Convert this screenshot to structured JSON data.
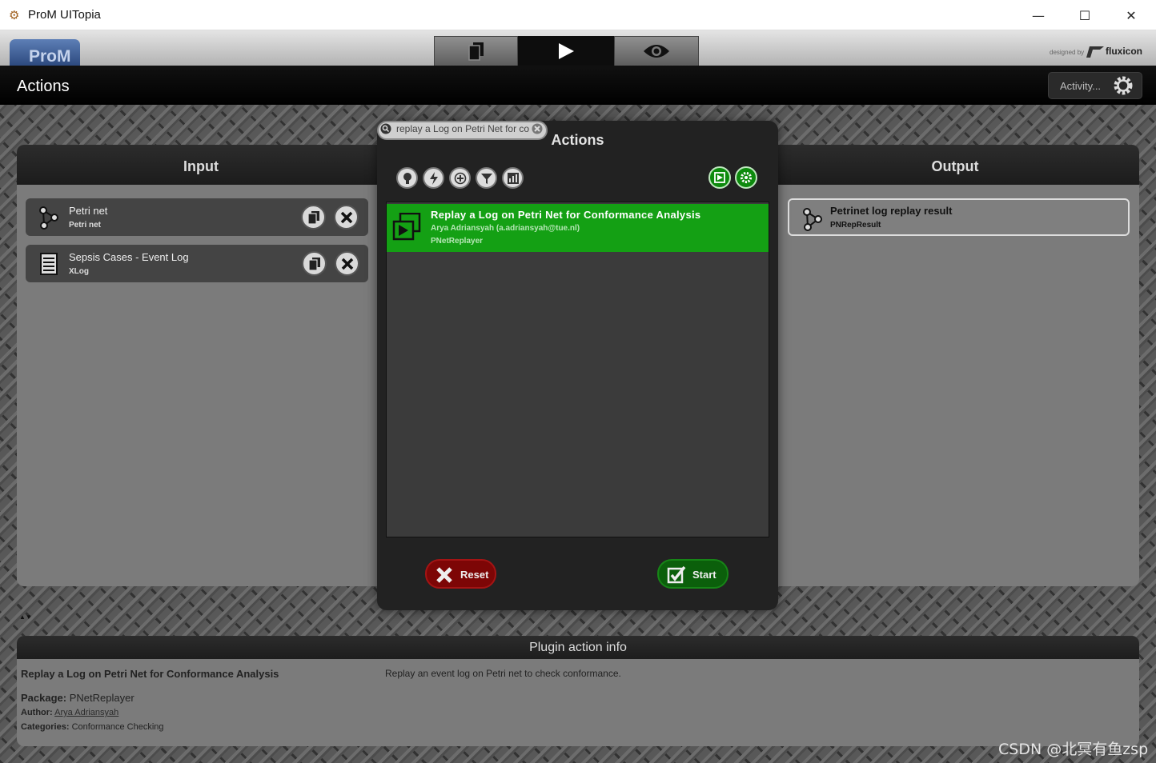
{
  "window": {
    "title": "ProM UITopia",
    "minimize_glyph": "—",
    "maximize_glyph": "☐",
    "close_glyph": "✕"
  },
  "header": {
    "logo": "ProM",
    "designed_by": "designed by",
    "brand": "fluxicon",
    "view_tabs": [
      "workspace",
      "actions",
      "views"
    ]
  },
  "actions_bar": {
    "title": "Actions",
    "activity_label": "Activity..."
  },
  "input_panel": {
    "title": "Input",
    "objects": [
      {
        "name": "Petri net",
        "type": "Petri net",
        "icon": "petri-net-icon"
      },
      {
        "name": "Sepsis Cases - Event Log",
        "type": "XLog",
        "icon": "document-icon"
      }
    ]
  },
  "output_panel": {
    "title": "Output",
    "objects": [
      {
        "name": "Petrinet log replay result",
        "type": "PNRepResult",
        "icon": "petri-net-icon"
      }
    ]
  },
  "actions_dialog": {
    "title": "Actions",
    "search_value": "replay a Log on Petri Net for co",
    "selected_action": {
      "title": "Replay a Log on Petri Net for Conformance Analysis",
      "author": "Arya Adriansyah (a.adriansyah@tue.nl)",
      "package": "PNetReplayer"
    },
    "reset_label": "Reset",
    "start_label": "Start"
  },
  "plugin_info": {
    "title": "Plugin action info",
    "name": "Replay a Log on Petri Net for Conformance Analysis",
    "description": "Replay an event log on Petri net to check conformance.",
    "package_label": "Package:",
    "package": "PNetReplayer",
    "author_label": "Author:",
    "author": "Arya Adriansyah",
    "categories_label": "Categories:",
    "categories": "Conformance Checking"
  },
  "watermark": "CSDN @北冥有鱼zsp",
  "colors": {
    "selected_green": "#14a014",
    "start_green": "#0b5f0b",
    "reset_red": "#7d0606"
  }
}
